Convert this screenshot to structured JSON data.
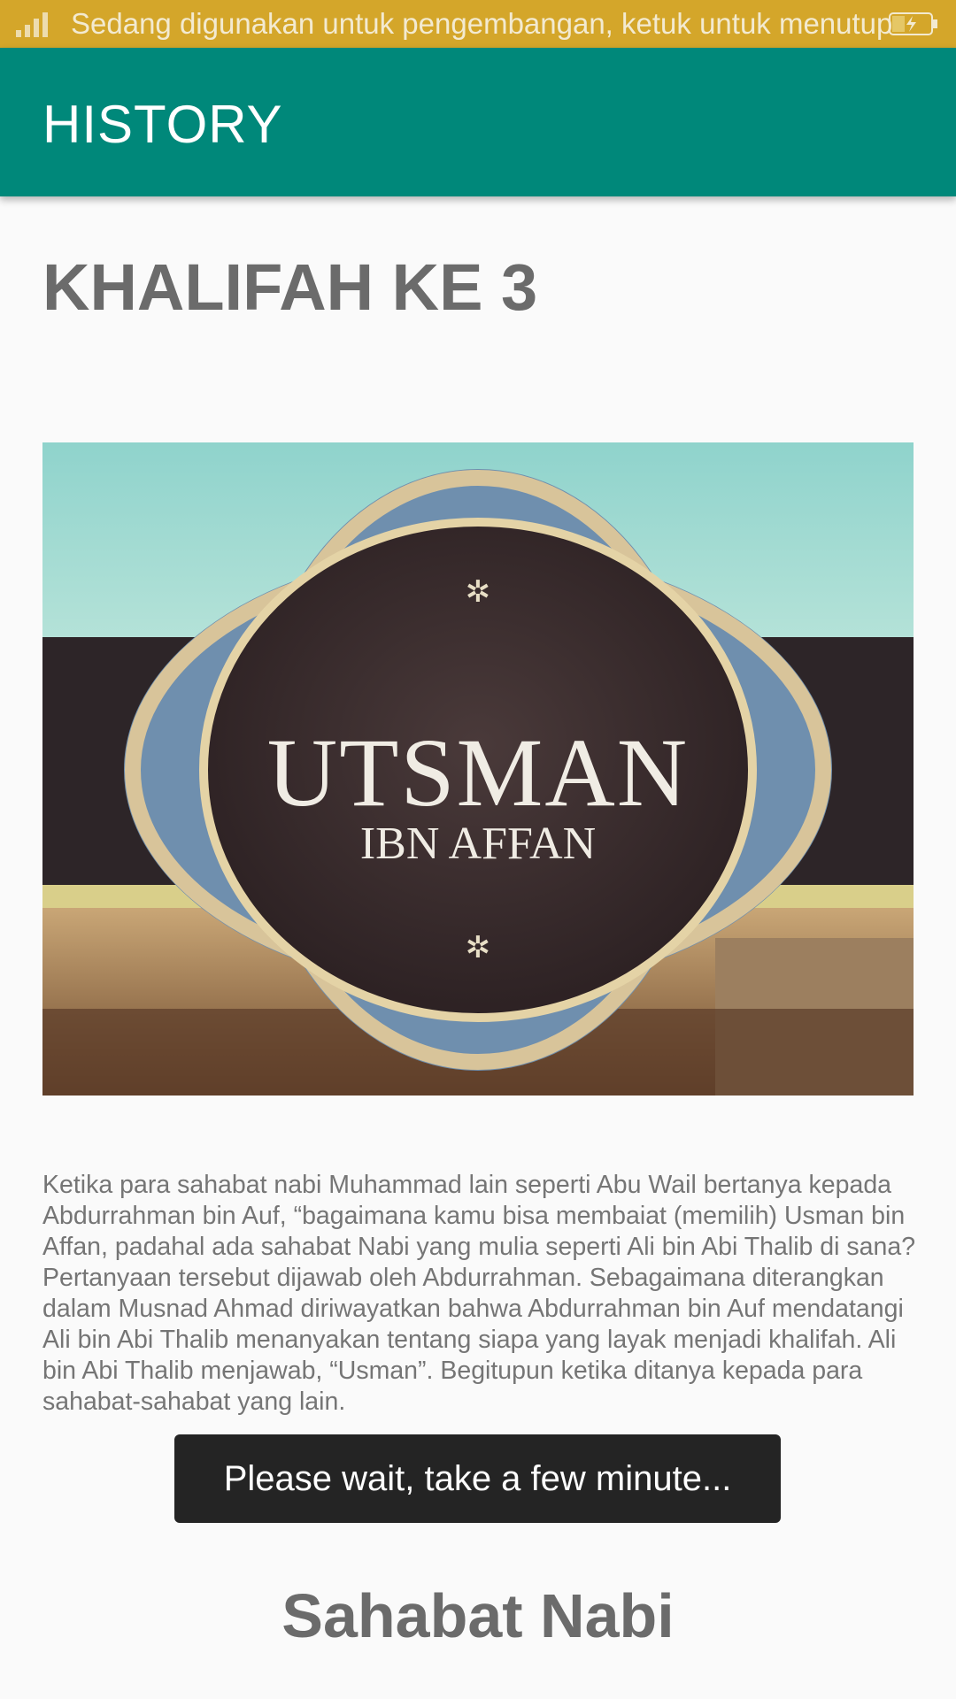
{
  "status_bar": {
    "notification": "Sedang digunakan untuk pengembangan, ketuk untuk menutup"
  },
  "app_bar": {
    "title": "HISTORY"
  },
  "content": {
    "heading": "KHALIFAH KE 3",
    "image": {
      "title": "UTSMAN",
      "subtitle": "IBN AFFAN"
    },
    "body": "Ketika para sahabat nabi Muhammad lain seperti Abu Wail bertanya kepada Abdurrahman bin Auf, “bagaimana kamu bisa membaiat (memilih) Usman bin Affan, padahal ada sahabat Nabi yang mulia seperti Ali bin Abi Thalib di sana?Pertanyaan tersebut dijawab oleh Abdurrahman. Sebagaimana diterangkan dalam Musnad Ahmad diriwayatkan bahwa Abdurrahman bin Auf mendatangi Ali bin Abi Thalib menanyakan tentang siapa yang layak menjadi khalifah. Ali bin Abi Thalib menjawab, “Usman”. Begitupun ketika ditanya kepada para sahabat-sahabat yang lain.",
    "section_title": "Sahabat Nabi"
  },
  "toast": {
    "message": "Please wait, take a few minute..."
  },
  "colors": {
    "status_bar": "#d4a62a",
    "app_bar": "#00887a",
    "text_gray": "#6b6b6b",
    "toast_bg": "#242424"
  }
}
